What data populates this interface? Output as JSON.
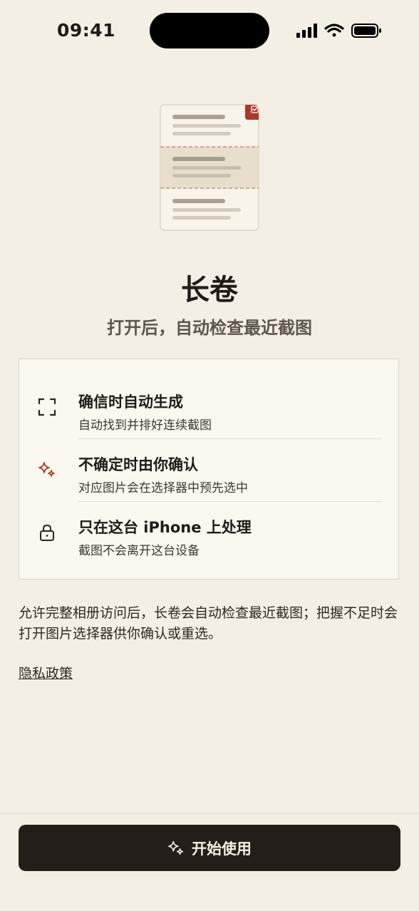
{
  "status_bar": {
    "time": "09:41"
  },
  "header": {
    "title": "长卷",
    "subtitle": "打开后，自动检查最近截图"
  },
  "features": [
    {
      "icon": "scan-frame-icon",
      "title": "确信时自动生成",
      "desc": "自动找到并排好连续截图"
    },
    {
      "icon": "sparkles-icon",
      "title": "不确定时由你确认",
      "desc": "对应图片会在选择器中预先选中"
    },
    {
      "icon": "lock-icon",
      "title": "只在这台 iPhone 上处理",
      "desc": "截图不会离开这台设备"
    }
  ],
  "note": "允许完整相册访问后，长卷会自动检查最近截图；把握不足时会打开图片选择器供你确认或重选。",
  "privacy_link": "隐私政策",
  "start_button": {
    "label": "开始使用",
    "icon": "sparkles-icon"
  },
  "colors": {
    "background": "#f3efe4",
    "card": "#fbf8f0",
    "accent": "#a83a2e",
    "button": "#231e19"
  }
}
